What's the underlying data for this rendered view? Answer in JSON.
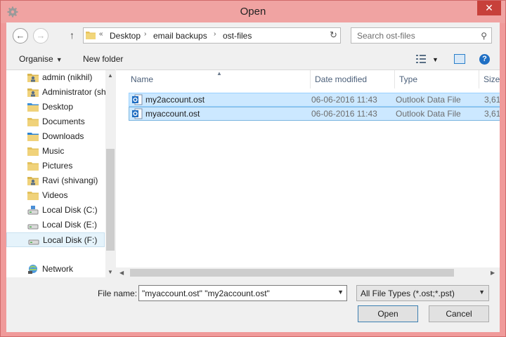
{
  "window": {
    "title": "Open",
    "close_glyph": "✕",
    "icon": "gear-icon"
  },
  "navigation": {
    "back_glyph": "←",
    "forward_glyph": "→",
    "up_glyph": "↑",
    "refresh_glyph": "↻",
    "breadcrumb": {
      "overflow": "«",
      "segments": [
        "Desktop",
        "email backups",
        "ost-files"
      ],
      "separator": "›"
    }
  },
  "search": {
    "placeholder": "Search ost-files",
    "icon_glyph": "⚲"
  },
  "toolbar": {
    "organise_label": "Organise",
    "new_folder_label": "New folder",
    "caret": "▼",
    "help_glyph": "?"
  },
  "nav_pane": {
    "items": [
      {
        "label": "admin (nikhil)",
        "icon": "user-folder-icon"
      },
      {
        "label": "Administrator (sh",
        "icon": "user-folder-icon"
      },
      {
        "label": "Desktop",
        "icon": "desktop-folder-icon"
      },
      {
        "label": "Documents",
        "icon": "documents-folder-icon"
      },
      {
        "label": "Downloads",
        "icon": "downloads-folder-icon"
      },
      {
        "label": "Music",
        "icon": "music-folder-icon"
      },
      {
        "label": "Pictures",
        "icon": "pictures-folder-icon"
      },
      {
        "label": "Ravi (shivangi)",
        "icon": "user-folder-icon"
      },
      {
        "label": "Videos",
        "icon": "videos-folder-icon"
      },
      {
        "label": "Local Disk (C:)",
        "icon": "windows-drive-icon"
      },
      {
        "label": "Local Disk (E:)",
        "icon": "drive-icon"
      },
      {
        "label": "Local Disk (F:)",
        "icon": "drive-icon"
      },
      {
        "label": "Network",
        "icon": "network-icon"
      }
    ],
    "selected": "Local Disk (F:)"
  },
  "file_list": {
    "columns": [
      "Name",
      "Date modified",
      "Type",
      "Size"
    ],
    "sort_caret": "▲",
    "rows": [
      {
        "name": "my2account.ost",
        "date": "06-06-2016 11:43",
        "type": "Outlook Data File",
        "size": "3,61"
      },
      {
        "name": "myaccount.ost",
        "date": "06-06-2016 11:43",
        "type": "Outlook Data File",
        "size": "3,61"
      }
    ]
  },
  "footer": {
    "file_name_label": "File name:",
    "file_name_value": "\"myaccount.ost\" \"my2account.ost\"",
    "file_type_value": "All File Types (*.ost;*.pst)",
    "open_label": "Open",
    "cancel_label": "Cancel",
    "dropdown_glyph": "▼"
  },
  "colors": {
    "title_bar": "#f0a3a2",
    "close_button": "#c7403a",
    "selection": "#cce8ff",
    "selection_border": "#99d1ff"
  }
}
